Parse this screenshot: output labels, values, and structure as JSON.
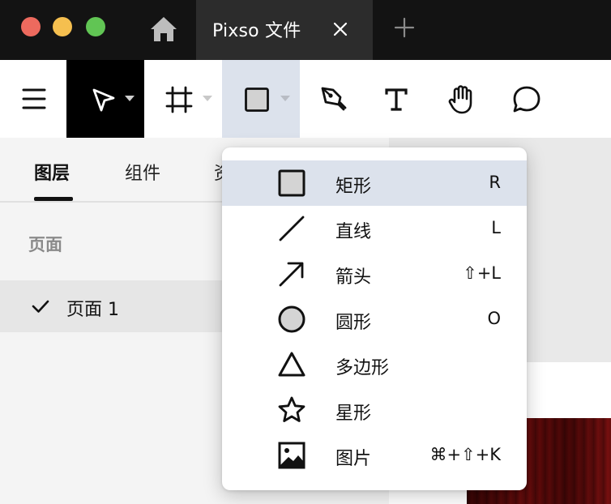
{
  "titlebar": {
    "tab_title": "Pixso 文件",
    "icons": [
      "home-icon",
      "close-icon",
      "plus-icon"
    ]
  },
  "toolbar": {
    "tools": [
      "menu-icon",
      "move-icon",
      "frame-icon",
      "rectangle-icon",
      "pen-icon",
      "text-icon",
      "hand-icon",
      "comment-icon"
    ],
    "selected_tool": "rectangle"
  },
  "left_panel": {
    "tabs": [
      "图层",
      "组件",
      "资"
    ],
    "active_tab": "图层",
    "section_title": "页面",
    "pages": [
      {
        "label": "页面 1",
        "checked": true
      }
    ]
  },
  "shape_menu": {
    "items": [
      {
        "label": "矩形",
        "shortcut": "R",
        "icon": "rectangle-icon",
        "selected": true
      },
      {
        "label": "直线",
        "shortcut": "L",
        "icon": "line-icon",
        "selected": false
      },
      {
        "label": "箭头",
        "shortcut": "⇧+L",
        "icon": "arrow-icon",
        "selected": false
      },
      {
        "label": "圆形",
        "shortcut": "O",
        "icon": "ellipse-icon",
        "selected": false
      },
      {
        "label": "多边形",
        "shortcut": "",
        "icon": "polygon-icon",
        "selected": false
      },
      {
        "label": "星形",
        "shortcut": "",
        "icon": "star-icon",
        "selected": false
      },
      {
        "label": "图片",
        "shortcut": "⌘+⇧+K",
        "icon": "image-icon",
        "selected": false
      }
    ]
  },
  "colors": {
    "titlebar_bg": "#131313",
    "active_tab_bg": "#2c2c2c",
    "selected_bg": "#dce2ec",
    "move_tool_bg": "#000000"
  }
}
